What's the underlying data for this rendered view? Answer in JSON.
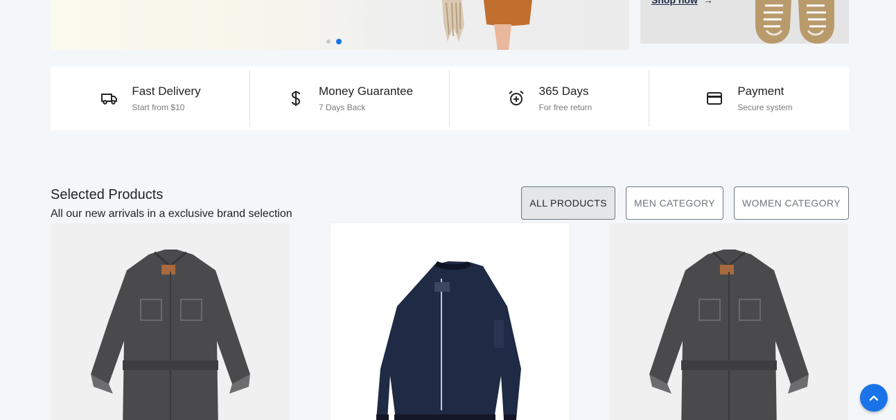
{
  "hero": {
    "slides": [
      {
        "active": false
      },
      {
        "active": true
      }
    ]
  },
  "promo": {
    "link_label": "Shop now",
    "link_arrow": "→"
  },
  "features": [
    {
      "icon": "truck-icon",
      "title": "Fast Delivery",
      "subtitle": "Start from $10"
    },
    {
      "icon": "dollar-icon",
      "title": "Money Guarantee",
      "subtitle": "7 Days Back"
    },
    {
      "icon": "alarm-clock-icon",
      "title": "365 Days",
      "subtitle": "For free return"
    },
    {
      "icon": "credit-card-icon",
      "title": "Payment",
      "subtitle": "Secure system"
    }
  ],
  "products_section": {
    "title": "Selected Products",
    "subtitle": "All our new arrivals in a exclusive brand selection",
    "filters": [
      {
        "label": "ALL PRODUCTS",
        "active": true
      },
      {
        "label": "MEN CATEGORY",
        "active": false
      },
      {
        "label": "WOMEN CATEGORY",
        "active": false
      }
    ]
  },
  "products": [
    {
      "image": "denim-dress"
    },
    {
      "image": "navy-bomber-jacket"
    },
    {
      "image": "denim-dress"
    }
  ],
  "colors": {
    "accent": "#1a73e8",
    "background": "#f4f7fa"
  },
  "scroll_top": {
    "icon": "chevron-up-icon"
  }
}
